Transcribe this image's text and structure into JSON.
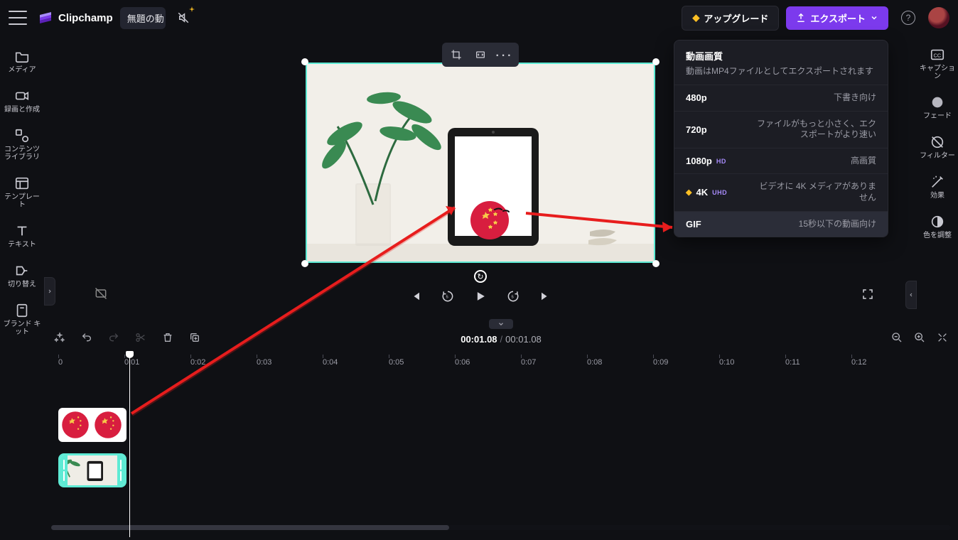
{
  "app": {
    "name": "Clipchamp",
    "title": "無題の動",
    "muted": true
  },
  "topbar": {
    "upgrade": "アップグレード",
    "export": "エクスポート"
  },
  "leftnav": [
    {
      "id": "media",
      "label": "メディア"
    },
    {
      "id": "record",
      "label": "録画と作成"
    },
    {
      "id": "library",
      "label": "コンテンツ\nライブラリ"
    },
    {
      "id": "templates",
      "label": "テンプレー\nト"
    },
    {
      "id": "text",
      "label": "テキスト"
    },
    {
      "id": "transitions",
      "label": "切り替え"
    },
    {
      "id": "brandkit",
      "label": "ブランド キ\nット"
    }
  ],
  "rightnav": [
    {
      "id": "captions",
      "label": "キャプショ\nン"
    },
    {
      "id": "fade",
      "label": "フェード"
    },
    {
      "id": "filters",
      "label": "フィルター"
    },
    {
      "id": "effects",
      "label": "効果"
    },
    {
      "id": "adjust",
      "label": "色を調整"
    }
  ],
  "popover": {
    "title": "動画画質",
    "subtitle": "動画はMP4ファイルとしてエクスポートされます",
    "rows": [
      {
        "q": "480p",
        "d": "下書き向け"
      },
      {
        "q": "720p",
        "d": "ファイルがもっと小さく、エクスポートがより速い"
      },
      {
        "q": "1080p",
        "badge": "HD",
        "d": "高画質"
      },
      {
        "q": "4K",
        "badge": "UHD",
        "premium": true,
        "d": "ビデオに 4K メディアがありません"
      },
      {
        "q": "GIF",
        "d": "15秒以下の動画向け",
        "hl": true
      }
    ]
  },
  "stage": {
    "ratio": "16:9"
  },
  "time": {
    "cur": "00:01.08",
    "dur": "00:01.08"
  },
  "ruler": [
    "0",
    "0:01",
    "0:02",
    "0:03",
    "0:04",
    "0:05",
    "0:06",
    "0:07",
    "0:08",
    "0:09",
    "0:10",
    "0:11",
    "0:12"
  ]
}
